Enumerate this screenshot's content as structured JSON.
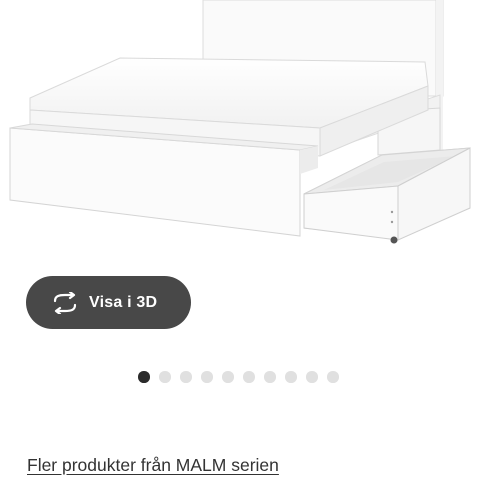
{
  "product_image": {
    "subject": "white bed frame with open storage drawer"
  },
  "view_3d": {
    "label": "Visa i 3D",
    "icon": "rotate-arrows-icon"
  },
  "carousel": {
    "total": 10,
    "active_index": 0
  },
  "series_link": {
    "label": "Fler produkter från MALM serien"
  },
  "colors": {
    "button_bg": "#484848",
    "dot_active": "#2b2b2b",
    "dot_inactive": "#e0e0e0"
  }
}
